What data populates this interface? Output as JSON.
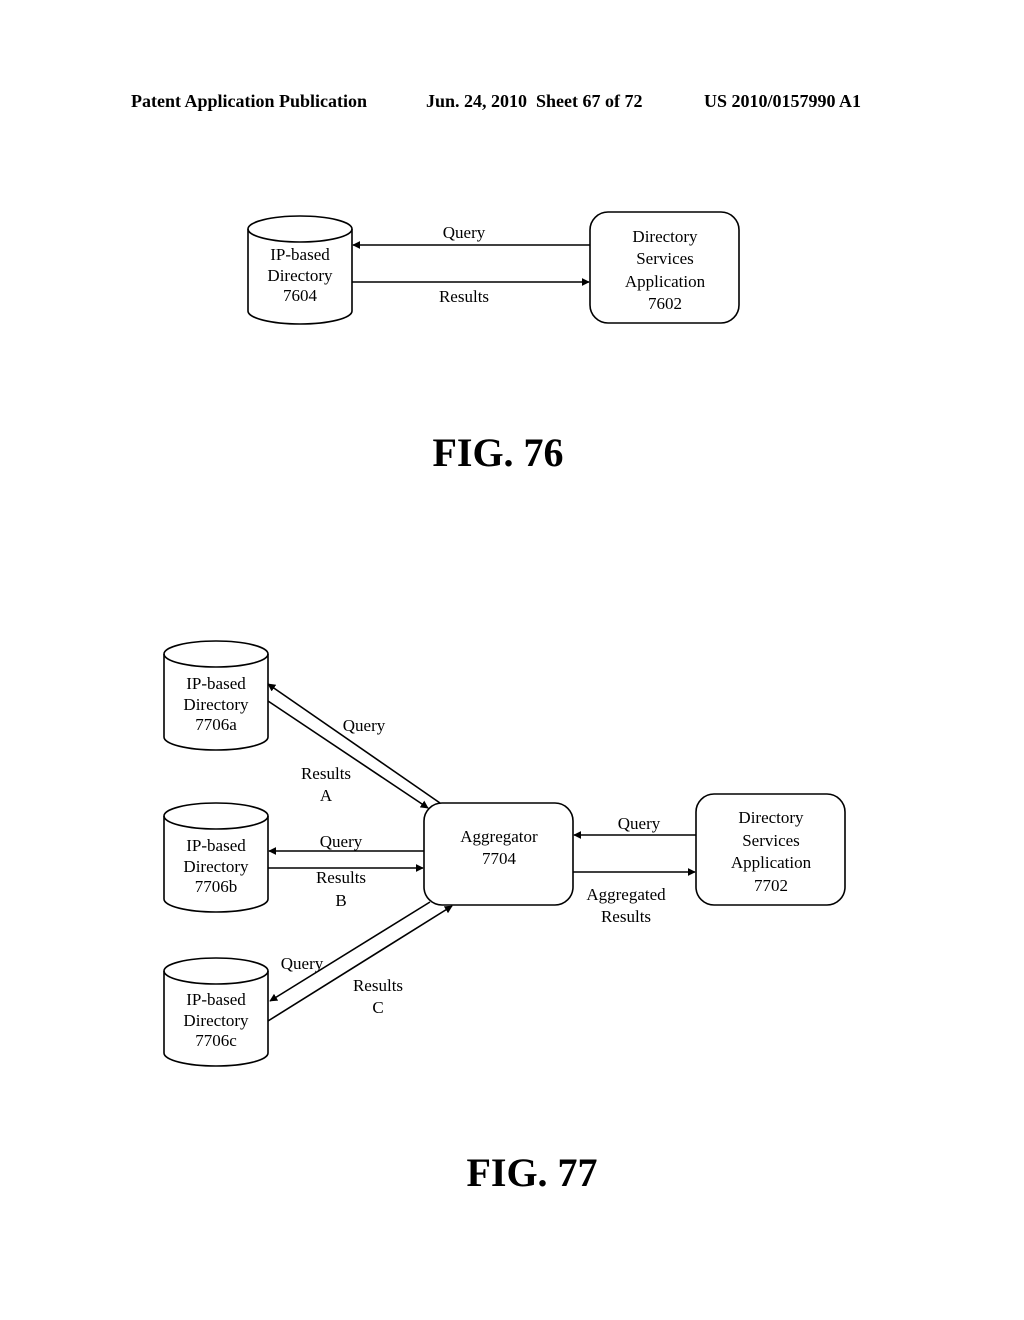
{
  "header": {
    "publication": "Patent Application Publication",
    "date_sheet": "Jun. 24, 2010  Sheet 67 of 72",
    "patent_number": "US 2010/0157990 A1"
  },
  "fig76": {
    "caption": "FIG. 76",
    "directory": {
      "lines": [
        "IP-based",
        "Directory",
        "7604"
      ]
    },
    "application": {
      "lines": [
        "Directory",
        "Services",
        "Application",
        "7602"
      ]
    },
    "arrows": {
      "query": "Query",
      "results": "Results"
    }
  },
  "fig77": {
    "caption": "FIG. 77",
    "directory_a": {
      "lines": [
        "IP-based",
        "Directory",
        "7706a"
      ]
    },
    "directory_b": {
      "lines": [
        "IP-based",
        "Directory",
        "7706b"
      ]
    },
    "directory_c": {
      "lines": [
        "IP-based",
        "Directory",
        "7706c"
      ]
    },
    "aggregator": {
      "lines": [
        "Aggregator",
        "7704"
      ]
    },
    "application": {
      "lines": [
        "Directory",
        "Services",
        "Application",
        "7702"
      ]
    },
    "arrows": {
      "query_a": "Query",
      "results_a": [
        "Results",
        "A"
      ],
      "query_b": "Query",
      "results_b": [
        "Results",
        "B"
      ],
      "query_c": "Query",
      "results_c": [
        "Results",
        "C"
      ],
      "query_app": "Query",
      "aggregated_results": [
        "Aggregated",
        "Results"
      ]
    }
  }
}
